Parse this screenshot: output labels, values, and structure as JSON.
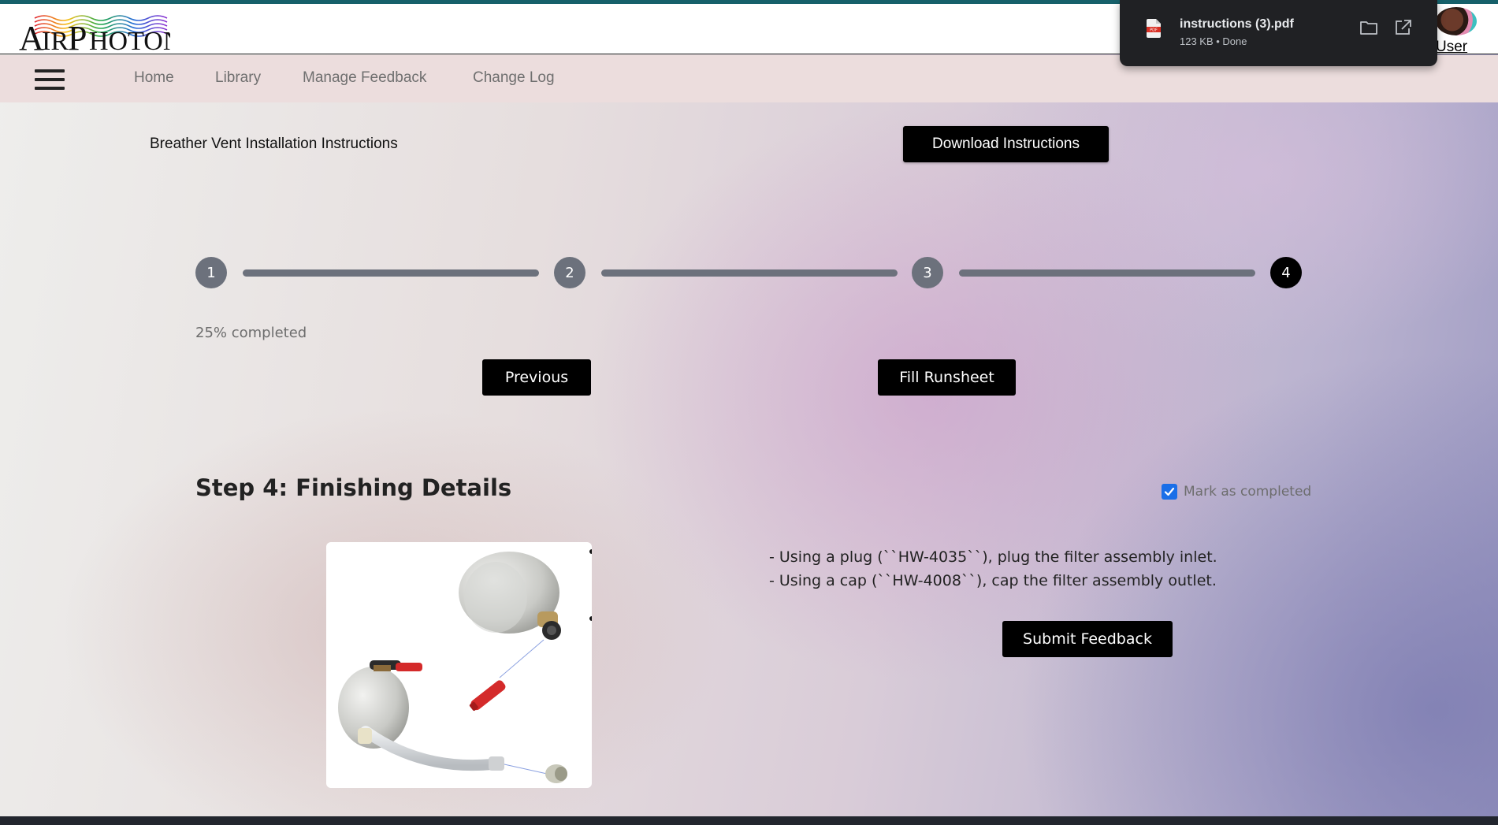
{
  "header": {
    "logo_alt": "AirPhoton",
    "user_label": "User"
  },
  "nav": {
    "items": [
      {
        "label": "Home"
      },
      {
        "label": "Library"
      },
      {
        "label": "Manage Feedback"
      },
      {
        "label": "Change Log"
      }
    ]
  },
  "page": {
    "title": "Breather Vent Installation Instructions",
    "download_label": "Download Instructions"
  },
  "stepper": {
    "steps": [
      "1",
      "2",
      "3",
      "4"
    ],
    "active_step": 4,
    "progress_text": "25% completed",
    "progress_fraction": 0.25,
    "previous_label": "Previous",
    "fill_label": "Fill Runsheet"
  },
  "step": {
    "heading": "Step 4: Finishing Details",
    "mark_completed_label": "Mark as completed",
    "mark_completed_checked": true,
    "instructions": [
      "- Using a plug (``HW-4035``), plug the filter assembly inlet.",
      "- Using a cap (``HW-4008``), cap the filter assembly outlet."
    ],
    "feedback_label": "Submit Feedback"
  },
  "download_popup": {
    "filename": "instructions (3).pdf",
    "status": "123 KB • Done",
    "icon": "pdf-file-icon"
  },
  "colors": {
    "accent_bar": "#16606a",
    "nav_bg": "#ecdddd",
    "step_inactive": "#6c717c",
    "step_active": "#000000",
    "checkbox": "#1a6fe8"
  }
}
